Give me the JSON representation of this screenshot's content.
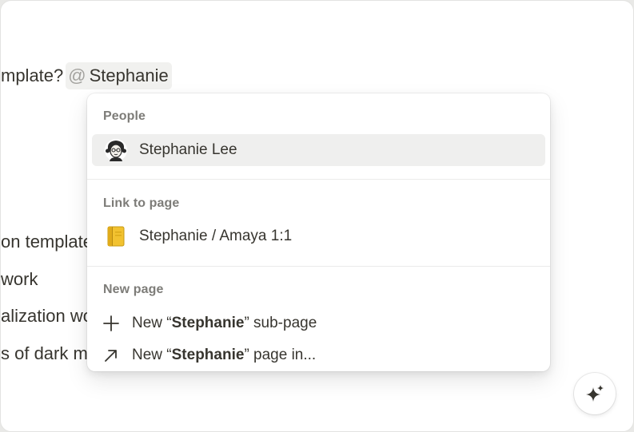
{
  "editor": {
    "line_main_prefix": "mplate?",
    "mention": {
      "at_symbol": "@",
      "query": "Stephanie"
    },
    "lines_clipped": [
      "on template",
      "work",
      "alization wo",
      "s of dark m"
    ]
  },
  "popup": {
    "sections": [
      {
        "label": "People",
        "items": [
          {
            "icon": "user-avatar",
            "label": "Stephanie Lee",
            "selected": true
          }
        ]
      },
      {
        "label": "Link to page",
        "items": [
          {
            "icon": "notebook-emoji",
            "label": "Stephanie / Amaya 1:1"
          }
        ]
      },
      {
        "label": "New page",
        "items": [
          {
            "icon": "plus-icon",
            "prefix": "New “",
            "bold": "Stephanie",
            "suffix": "” sub-page"
          },
          {
            "icon": "arrow-up-right-icon",
            "prefix": "New “",
            "bold": "Stephanie",
            "suffix": "” page in..."
          }
        ]
      }
    ]
  },
  "colors": {
    "text": "#37352f",
    "muted": "#7d7c78",
    "selected_bg": "#efefee"
  }
}
